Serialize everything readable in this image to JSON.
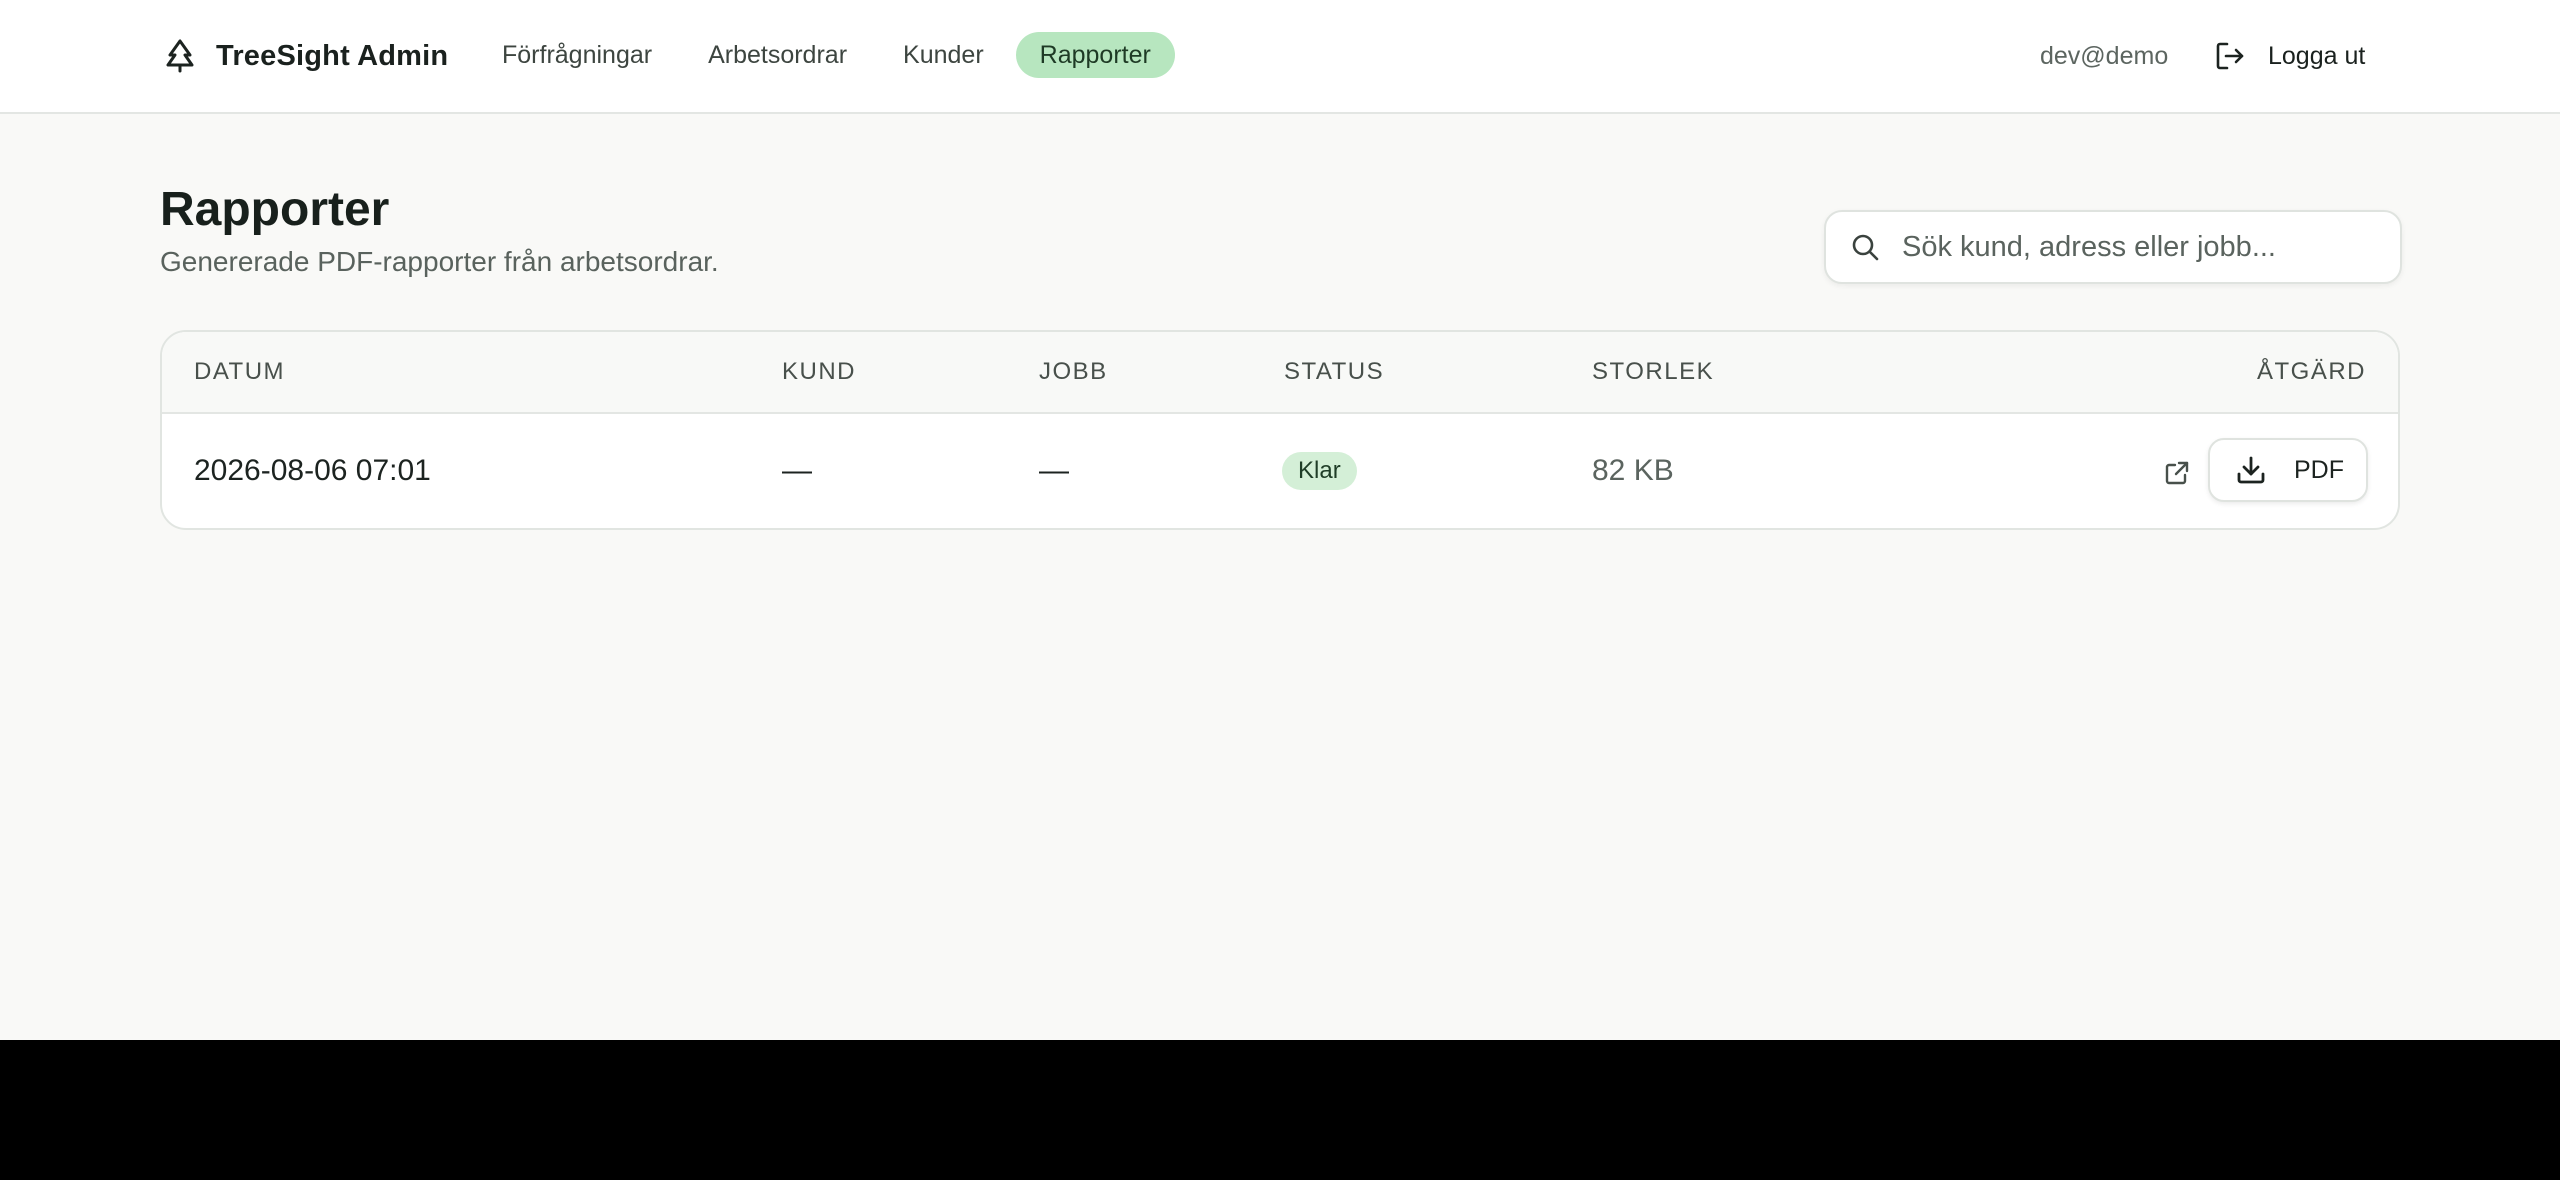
{
  "header": {
    "brand": "TreeSight Admin",
    "logo_icon": "tree-icon",
    "nav": [
      {
        "label": "Förfrågningar",
        "active": false
      },
      {
        "label": "Arbetsordrar",
        "active": false
      },
      {
        "label": "Kunder",
        "active": false
      },
      {
        "label": "Rapporter",
        "active": true
      }
    ],
    "user_email": "dev@demo",
    "logout_label": "Logga ut",
    "logout_icon": "logout-icon"
  },
  "page": {
    "title": "Rapporter",
    "subtitle": "Genererade PDF-rapporter från arbetsordrar."
  },
  "search": {
    "placeholder": "Sök kund, adress eller jobb...",
    "value": "",
    "icon": "search-icon"
  },
  "table": {
    "columns": [
      "DATUM",
      "KUND",
      "JOBB",
      "STATUS",
      "STORLEK",
      "ÅTGÄRD"
    ],
    "rows": [
      {
        "datum": "2026-08-06 07:01",
        "kund": "—",
        "jobb": "—",
        "status": "Klar",
        "storlek": "82 KB",
        "open_icon": "external-link-icon",
        "action_label": "PDF",
        "action_icon": "download-icon"
      }
    ]
  },
  "colors": {
    "accent": "#b7e6bf",
    "badge_bg": "#d4efd7",
    "page_bg": "#f9f9f7"
  }
}
